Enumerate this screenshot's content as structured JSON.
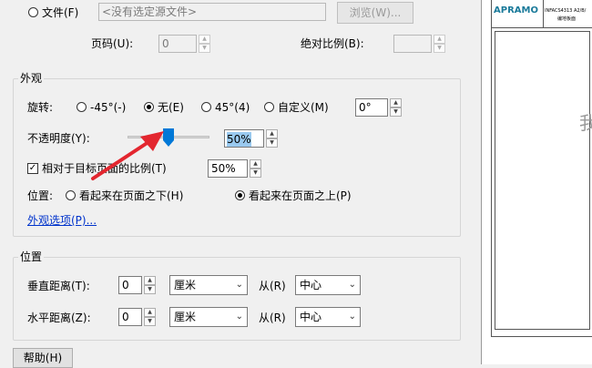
{
  "source": {
    "file_label": "文件(F)",
    "file_value": "<没有选定源文件>",
    "browse_label": "浏览(W)...",
    "page_label": "页码(U):",
    "page_value": "0",
    "abs_scale_label": "绝对比例(B):",
    "abs_scale_value": ""
  },
  "appearance": {
    "title": "外观",
    "rotation_label": "旋转:",
    "rot_neg45": "-45°(-)",
    "rot_none": "无(E)",
    "rot_45": "45°(4)",
    "rot_custom": "自定义(M)",
    "rot_custom_value": "0°",
    "opacity_label": "不透明度(Y):",
    "opacity_value": "50%",
    "opacity_level": 0.5,
    "relative_scale_label": "相对于目标页面的比例(T)",
    "relative_scale_value": "50%",
    "position_label": "位置:",
    "pos_behind": "看起来在页面之下(H)",
    "pos_front": "看起来在页面之上(P)",
    "options_link": "外观选项(P)..."
  },
  "position": {
    "title": "位置",
    "vertical_label": "垂直距离(T):",
    "vertical_value": "0",
    "vertical_unit": "厘米",
    "vertical_from_label": "从(R)",
    "vertical_from": "中心",
    "horizontal_label": "水平距离(Z):",
    "horizontal_value": "0",
    "horizontal_unit": "厘米",
    "horizontal_from_label": "从(R)",
    "horizontal_from": "中心"
  },
  "help_label": "帮助(H)",
  "preview": {
    "logo": "APRAMO",
    "header_text": "INFACS4313 A2/B/",
    "header_sub": "编地板面",
    "watermark_char": "我"
  },
  "colors": {
    "accent": "#0078d7",
    "arrow": "#e3262f"
  }
}
